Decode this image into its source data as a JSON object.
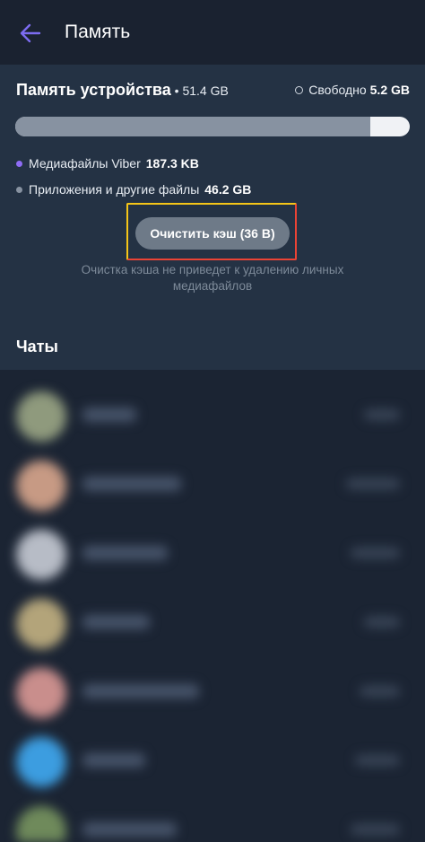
{
  "appbar": {
    "title": "Память",
    "back_icon": "arrow-left-icon",
    "accent": "#7c6cf0"
  },
  "storage": {
    "title": "Память устройства",
    "separator": " • ",
    "total": "51.4 GB",
    "free_label": "Свободно",
    "free_value": "5.2 GB",
    "used_fraction": 0.9,
    "legend": [
      {
        "label": "Медиафайлы Viber",
        "value": "187.3 KB",
        "color": "#8f6cf5"
      },
      {
        "label": "Приложения и другие файлы",
        "value": "46.2 GB",
        "color": "#8792a1"
      }
    ],
    "clear_button": "Очистить кэш (36 B)",
    "hint": "Очистка кэша не приведет к удалению личных медиафайлов"
  },
  "chats": {
    "header": "Чаты",
    "items": [
      {
        "avatar_color": "#8f9a7d"
      },
      {
        "avatar_color": "#c79a84"
      },
      {
        "avatar_color": "#b7bcc6"
      },
      {
        "avatar_color": "#b3a47a"
      },
      {
        "avatar_color": "#c98e8c"
      },
      {
        "avatar_color": "#3c9de0"
      },
      {
        "avatar_color": "#6f8a5b"
      }
    ]
  }
}
